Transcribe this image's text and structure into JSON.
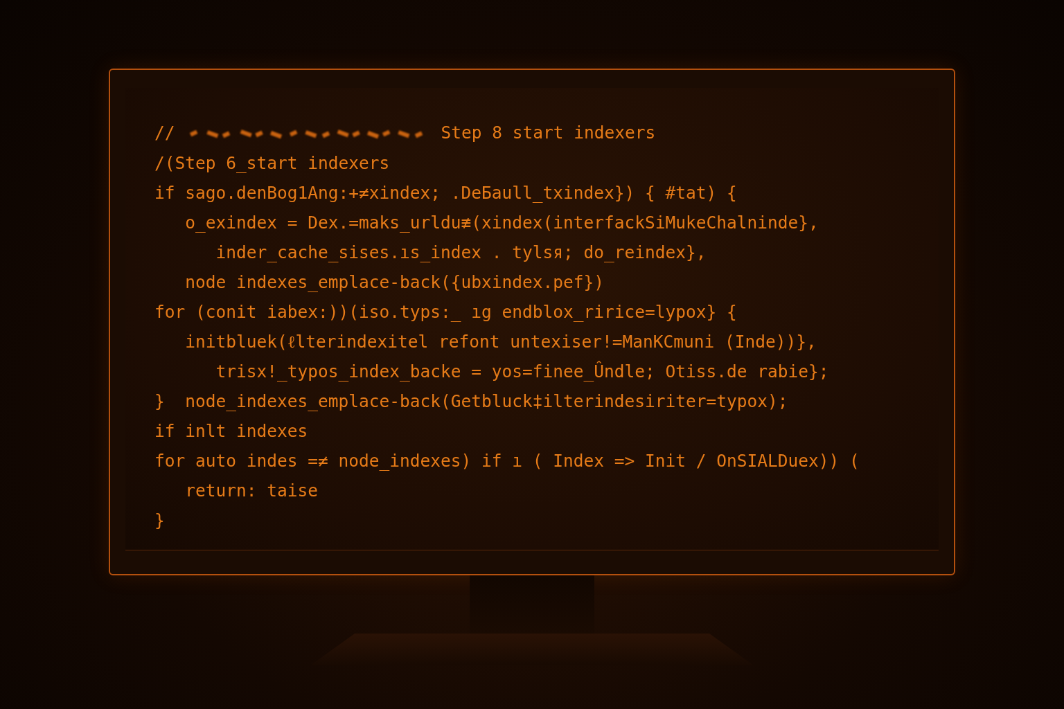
{
  "header_comment": {
    "prefix": "//",
    "text": "Step 8 start indexers"
  },
  "code_lines": [
    "/(Step 6_start indexers",
    "if sago.denBog1Ang:+≠xindex; .DeБaull_txindex}) { #tat) {",
    "   o_exindex = Dex.=maks_urldu≢(xindex(interfackSiMukeChalninde},",
    "      inder_cache_sises.ıs_index . tylsя; do_reindex},",
    "   node indexes_emplace-back({ubxindex.pef})",
    "for (conit iabex:))(iso.typs:_ ıg endblox_ririce=lypox} {",
    "   initbluek(ℓlterindexitel refont untexiser!=ManKCmuni (Inde))},",
    "      trisx!_typos_index_backe = yos=finee_Ûndle; Otiss.de rabie};",
    "}  node_indexes_emplace-back(Getbluck‡ilterindesiriter=typox);",
    "if inlt indexes",
    "for auto indes =≠ node_indexes) if ı ( Index => Init / OnSIALDuex)) (",
    "   return: taise",
    "}"
  ]
}
